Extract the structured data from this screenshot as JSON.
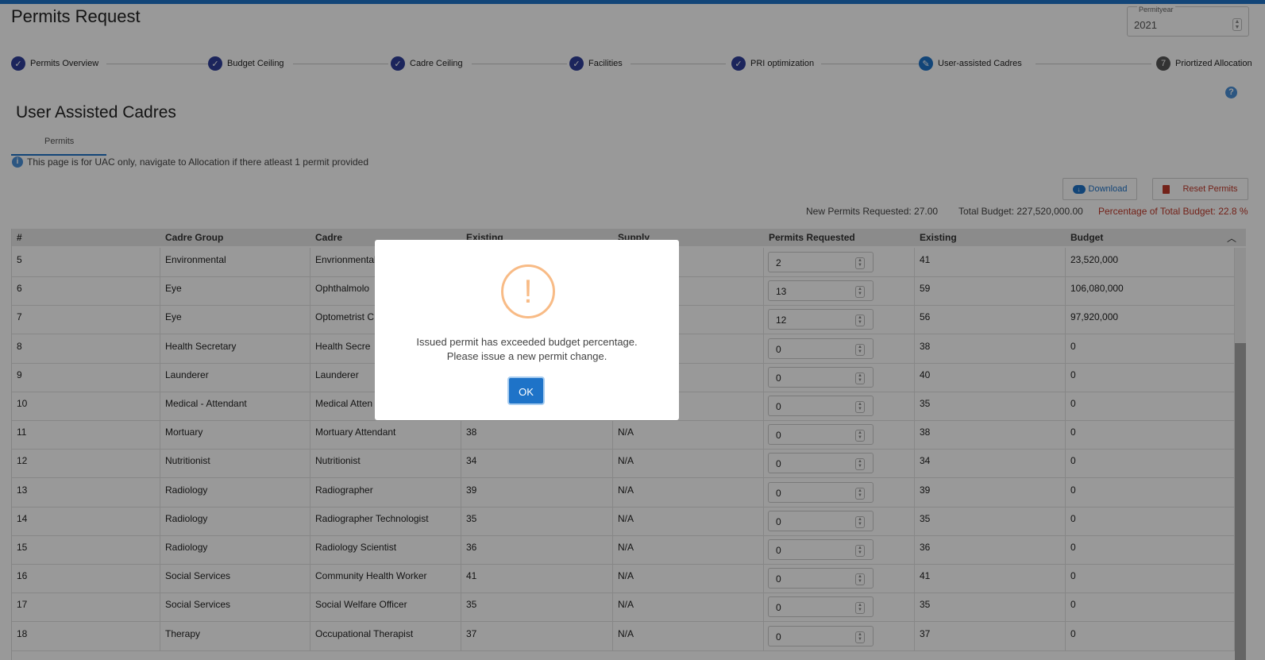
{
  "header": {
    "title": "Permits Request",
    "year_label": "Permityear",
    "year_value": "2021"
  },
  "stepper": [
    {
      "label": "Permits Overview",
      "status": "done"
    },
    {
      "label": "Budget Ceiling",
      "status": "done"
    },
    {
      "label": "Cadre Ceiling",
      "status": "done"
    },
    {
      "label": "Facilities",
      "status": "done"
    },
    {
      "label": "PRI optimization",
      "status": "done"
    },
    {
      "label": "User-assisted Cadres",
      "status": "active"
    },
    {
      "label": "Priortized Allocation",
      "status": "pending",
      "number": "7"
    }
  ],
  "section": {
    "title": "User Assisted Cadres",
    "tab_label": "Permits",
    "info_text": "This page is for UAC only, navigate to Allocation if there atleast 1 permit provided",
    "help_icon": "?"
  },
  "toolbar": {
    "download_label": "Download",
    "reset_label": "Reset Permits"
  },
  "summary": {
    "new_permits": "New Permits Requested: 27.00",
    "total_budget": "Total Budget: 227,520,000.00",
    "percentage": "Percentage of Total Budget: 22.8 %"
  },
  "table": {
    "columns": [
      "#",
      "Cadre Group",
      "Cadre",
      "Existing",
      "Supply",
      "Permits Requested",
      "Existing",
      "Budget"
    ],
    "rows": [
      {
        "num": "5",
        "group": "Environmental",
        "cadre": "Envrionmental",
        "existing": "",
        "supply": "",
        "requested": "2",
        "existing2": "41",
        "budget": "23,520,000"
      },
      {
        "num": "6",
        "group": "Eye",
        "cadre": "Ophthalmolo",
        "existing": "",
        "supply": "",
        "requested": "13",
        "existing2": "59",
        "budget": "106,080,000"
      },
      {
        "num": "7",
        "group": "Eye",
        "cadre": "Optometrist C",
        "existing": "",
        "supply": "",
        "requested": "12",
        "existing2": "56",
        "budget": "97,920,000"
      },
      {
        "num": "8",
        "group": "Health Secretary",
        "cadre": "Health Secre",
        "existing": "",
        "supply": "",
        "requested": "0",
        "existing2": "38",
        "budget": "0"
      },
      {
        "num": "9",
        "group": "Launderer",
        "cadre": "Launderer",
        "existing": "",
        "supply": "",
        "requested": "0",
        "existing2": "40",
        "budget": "0"
      },
      {
        "num": "10",
        "group": "Medical - Attendant",
        "cadre": "Medical Atten",
        "existing": "",
        "supply": "",
        "requested": "0",
        "existing2": "35",
        "budget": "0"
      },
      {
        "num": "11",
        "group": "Mortuary",
        "cadre": "Mortuary Attendant",
        "existing": "38",
        "supply": "N/A",
        "requested": "0",
        "existing2": "38",
        "budget": "0"
      },
      {
        "num": "12",
        "group": "Nutritionist",
        "cadre": "Nutritionist",
        "existing": "34",
        "supply": "N/A",
        "requested": "0",
        "existing2": "34",
        "budget": "0"
      },
      {
        "num": "13",
        "group": "Radiology",
        "cadre": "Radiographer",
        "existing": "39",
        "supply": "N/A",
        "requested": "0",
        "existing2": "39",
        "budget": "0"
      },
      {
        "num": "14",
        "group": "Radiology",
        "cadre": "Radiographer Technologist",
        "existing": "35",
        "supply": "N/A",
        "requested": "0",
        "existing2": "35",
        "budget": "0"
      },
      {
        "num": "15",
        "group": "Radiology",
        "cadre": "Radiology Scientist",
        "existing": "36",
        "supply": "N/A",
        "requested": "0",
        "existing2": "36",
        "budget": "0"
      },
      {
        "num": "16",
        "group": "Social Services",
        "cadre": "Community Health Worker",
        "existing": "41",
        "supply": "N/A",
        "requested": "0",
        "existing2": "41",
        "budget": "0"
      },
      {
        "num": "17",
        "group": "Social Services",
        "cadre": "Social Welfare Officer",
        "existing": "35",
        "supply": "N/A",
        "requested": "0",
        "existing2": "35",
        "budget": "0"
      },
      {
        "num": "18",
        "group": "Therapy",
        "cadre": "Occupational Therapist",
        "existing": "37",
        "supply": "N/A",
        "requested": "0",
        "existing2": "37",
        "budget": "0"
      }
    ]
  },
  "modal": {
    "icon": "!",
    "line1": "Issued permit has exceeded budget percentage.",
    "line2": "Please issue a new permit change.",
    "ok_label": "OK"
  },
  "colors": {
    "accent": "#1e73c8",
    "step_done": "#2f3f9a",
    "warning": "#f8bb86",
    "danger": "#c0392b"
  }
}
